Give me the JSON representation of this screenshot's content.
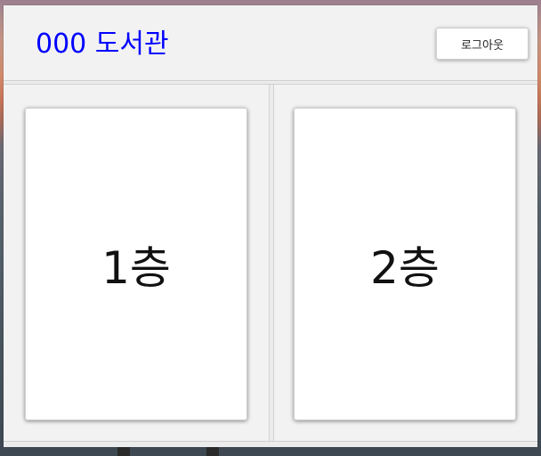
{
  "header": {
    "title": "000 도서관",
    "logout_label": "로그아웃"
  },
  "floors": [
    {
      "label": "1층"
    },
    {
      "label": "2층"
    }
  ],
  "colors": {
    "title": "#0000ff",
    "window_bg": "#f2f2f2",
    "card_bg": "#ffffff"
  }
}
